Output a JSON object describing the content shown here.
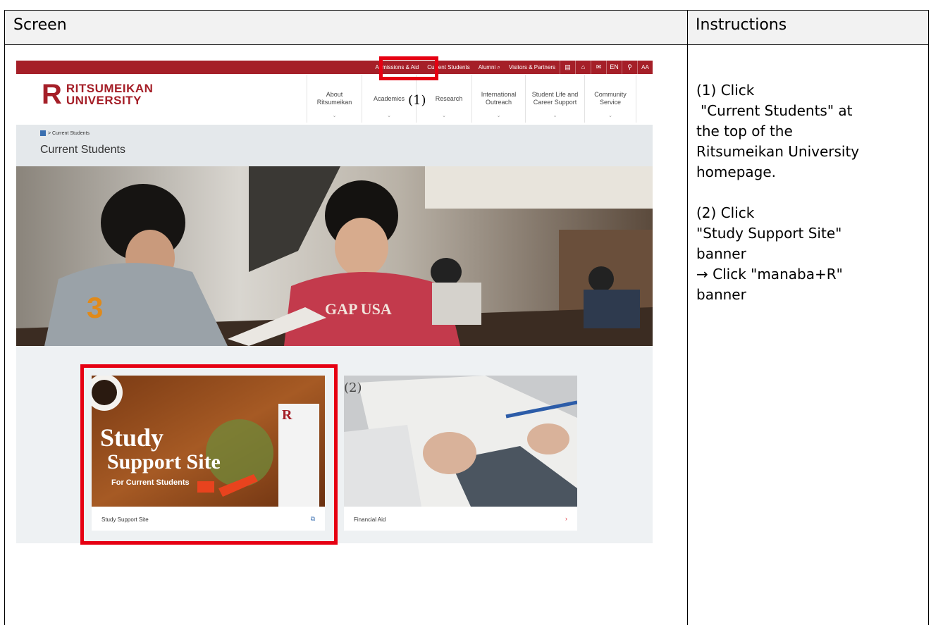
{
  "table": {
    "col_screen": "Screen",
    "col_instructions": "Instructions"
  },
  "instructions": {
    "step1_line1": "(1) Click",
    "step1_line2": "\"Current Students\" at",
    "step1_line3": "the top of the",
    "step1_line4": "Ritsumeikan University",
    "step1_line5": "homepage.",
    "step2_line1": "(2) Click",
    "step2_line2": "\"Study Support Site\"",
    "step2_line3": "banner",
    "step2_line4": "→ Click \"manaba+R\"",
    "step2_line5": "banner"
  },
  "site": {
    "topnav": [
      "Admissions & Aid",
      "Current Students",
      "Alumni"
    ],
    "visitors": "Visitors & Partners",
    "lang": "EN",
    "fontsize": "AA",
    "logo_mark": "R",
    "logo_line1": "RITSUMEIKAN",
    "logo_line2": "UNIVERSITY",
    "mainnav": [
      {
        "l1": "About",
        "l2": "Ritsumeikan"
      },
      {
        "l1": "Academics",
        "l2": ""
      },
      {
        "l1": "Research",
        "l2": ""
      },
      {
        "l1": "International",
        "l2": "Outreach"
      },
      {
        "l1": "Student Life and",
        "l2": "Career Support"
      },
      {
        "l1": "Community",
        "l2": "Service"
      }
    ],
    "breadcrumb": "> Current Students",
    "page_title": "Current Students",
    "hero_shirt": "GAP USA",
    "card1": {
      "title_line1": "Study",
      "title_line2": "Support Site",
      "subtitle": "For Current Students",
      "caption": "Study Support Site"
    },
    "card2": {
      "caption": "Financial Aid"
    }
  },
  "markers": {
    "m1": "(1)",
    "m2": "(2)"
  },
  "colors": {
    "brand_red": "#a51f28",
    "highlight_red": "#e60012"
  }
}
